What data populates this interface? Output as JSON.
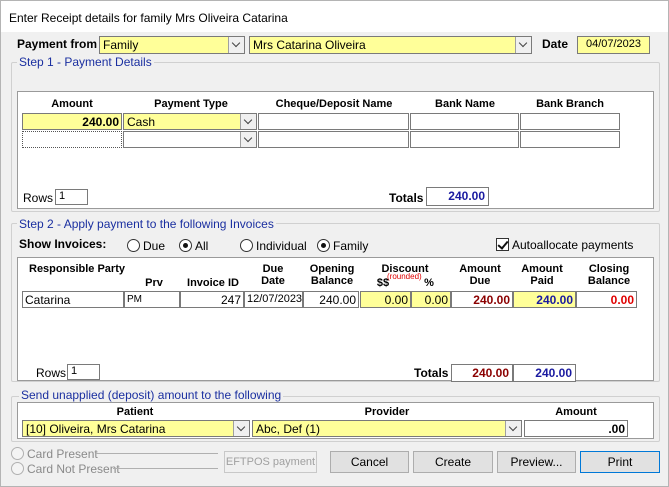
{
  "window": {
    "title": "Enter Receipt details for family Mrs  Oliveira  Catarina"
  },
  "header": {
    "payment_from_label": "Payment from",
    "payment_from_type": "Family",
    "payment_from_name": "Mrs Catarina  Oliveira",
    "date_label": "Date",
    "date_value": "04/07/2023"
  },
  "step1": {
    "title": "Step 1 - Payment Details",
    "columns": [
      "Amount",
      "Payment Type",
      "Cheque/Deposit Name",
      "Bank Name",
      "Bank Branch"
    ],
    "rows": [
      {
        "amount": "240.00",
        "payment_type": "Cash",
        "cheque_name": "",
        "bank_name": "",
        "bank_branch": ""
      },
      {
        "amount": "",
        "payment_type": "",
        "cheque_name": "",
        "bank_name": "",
        "bank_branch": ""
      }
    ],
    "rows_label": "Rows",
    "rows_value": "1",
    "totals_label": "Totals",
    "totals_value": "240.00"
  },
  "step2": {
    "title": "Step 2 - Apply payment to the following Invoices",
    "show_invoices_label": "Show Invoices:",
    "filter_due": "Due",
    "filter_all": "All",
    "filter_individual": "Individual",
    "filter_family": "Family",
    "autoallocate_label": "Autoallocate payments",
    "columns": {
      "responsible_party": "Responsible Party",
      "prv": "Prv",
      "invoice_id": "Invoice ID",
      "due_date": "Due Date",
      "opening_balance": "Opening Balance",
      "discount": "Discount",
      "discount_rounded": "(rounded)",
      "discount_dollars": "$$",
      "discount_percent": "%",
      "amount_due": "Amount Due",
      "amount_paid": "Amount Paid",
      "closing_balance": "Closing Balance"
    },
    "rows": [
      {
        "responsible_party": "Catarina",
        "prv": "PM",
        "invoice_id": "247",
        "due_date": "12/07/2023",
        "opening_balance": "240.00",
        "discount_dollars": "0.00",
        "discount_percent": "0.00",
        "amount_due": "240.00",
        "amount_paid": "240.00",
        "closing_balance": "0.00"
      }
    ],
    "rows_label": "Rows",
    "rows_value": "1",
    "totals_label": "Totals",
    "totals_due": "240.00",
    "totals_paid": "240.00"
  },
  "unapplied": {
    "title": "Send unapplied (deposit) amount to the following",
    "patient_label": "Patient",
    "provider_label": "Provider",
    "amount_label": "Amount",
    "patient_value": "[10] Oliveira, Mrs Catarina",
    "provider_value": "Abc,  Def  (1)",
    "amount_value": ".00"
  },
  "footer": {
    "card_present": "Card Present",
    "card_not_present": "Card Not Present",
    "eftpos_button": "EFTPOS payment",
    "cancel_button": "Cancel",
    "create_button": "Create",
    "preview_button": "Preview...",
    "print_button": "Print"
  }
}
